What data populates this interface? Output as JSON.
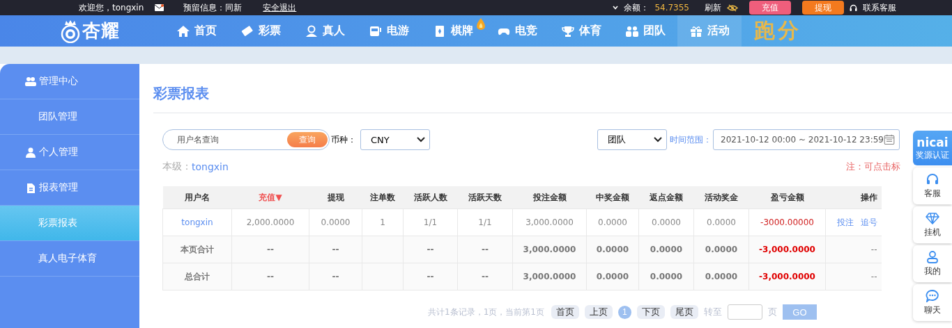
{
  "top_bar": {
    "welcome": "欢迎您，tongxin",
    "reserved_info": "预留信息：同新",
    "logout": "安全退出",
    "balance_label": "余额：",
    "balance": "54.7355",
    "refresh": "刷新",
    "deposit": "充值",
    "withdraw": "提现",
    "support": "联系客服"
  },
  "logo": "杏耀",
  "nav": [
    {
      "label": "首页",
      "selected": false,
      "hot": false
    },
    {
      "label": "彩票",
      "selected": false,
      "hot": false
    },
    {
      "label": "真人",
      "selected": false,
      "hot": false
    },
    {
      "label": "电游",
      "selected": false,
      "hot": false
    },
    {
      "label": "棋牌",
      "selected": false,
      "hot": true
    },
    {
      "label": "电竞",
      "selected": false,
      "hot": false
    },
    {
      "label": "体育",
      "selected": false,
      "hot": false
    },
    {
      "label": "团队",
      "selected": false,
      "hot": false
    },
    {
      "label": "活动",
      "selected": true,
      "hot": false
    }
  ],
  "nav_promo": "跑分",
  "sidebar": [
    {
      "label": "管理中心",
      "kind": "group",
      "selected": false
    },
    {
      "label": "团队管理",
      "kind": "item",
      "selected": false
    },
    {
      "label": "个人管理",
      "kind": "group",
      "selected": false
    },
    {
      "label": "报表管理",
      "kind": "group",
      "selected": false
    },
    {
      "label": "彩票报表",
      "kind": "item",
      "selected": true
    },
    {
      "label": "真人电子体育",
      "kind": "item",
      "selected": false
    }
  ],
  "page_title": "彩票报表",
  "filters": {
    "search_placeholder": "用户名查询",
    "search_button": "查询",
    "currency_label": "币种：",
    "currency": "CNY",
    "scope": "团队",
    "time_label": "时间范围：",
    "time_range": "2021-10-12 00:00 ~ 2021-10-12 23:59"
  },
  "level_label": "本级：",
  "level_user": "tongxin",
  "note": "注：可点击标",
  "table": {
    "columns": [
      {
        "label": "用户名",
        "sorted": false
      },
      {
        "label": "充值▼",
        "sorted": true
      },
      {
        "label": "提现",
        "sorted": false
      },
      {
        "label": "注单数",
        "sorted": false
      },
      {
        "label": "活跃人数",
        "sorted": false
      },
      {
        "label": "活跃天数",
        "sorted": false
      },
      {
        "label": "投注金额",
        "sorted": false
      },
      {
        "label": "中奖金额",
        "sorted": false
      },
      {
        "label": "返点金额",
        "sorted": false
      },
      {
        "label": "活动奖金",
        "sorted": false
      },
      {
        "label": "盈亏金额",
        "sorted": false
      },
      {
        "label": "操作",
        "sorted": false
      }
    ],
    "rows": [
      {
        "kind": "data",
        "cells": [
          "tongxin",
          "2,000.0000",
          "0.0000",
          "1",
          "1/1",
          "1/1",
          "3,000.0000",
          "0.0000",
          "0.0000",
          "0.0000",
          "-3000.00000"
        ],
        "actions": [
          "投注",
          "追号"
        ]
      },
      {
        "kind": "total",
        "cells": [
          "本页合计",
          "--",
          "--",
          "",
          "--",
          "--",
          "3,000.0000",
          "0.0000",
          "0.0000",
          "0.0000",
          "-3,000.0000",
          "--"
        ]
      },
      {
        "kind": "total",
        "cells": [
          "总合计",
          "--",
          "--",
          "",
          "--",
          "--",
          "3,000.0000",
          "0.0000",
          "0.0000",
          "0.0000",
          "-3,000.0000",
          "--"
        ]
      }
    ]
  },
  "pagination": {
    "summary": "共计1条记录，1页，当前第1页",
    "first": "首页",
    "prev": "上页",
    "pages": [
      {
        "label": "1",
        "selected": true
      }
    ],
    "next": "下页",
    "last": "尾页",
    "goto_label": "转至",
    "page_unit": "页",
    "go": "GO"
  },
  "float_panel": {
    "badge_top": "nicai",
    "badge_bottom": "奖源认证",
    "items": [
      {
        "label": "客服"
      },
      {
        "label": "挂机"
      },
      {
        "label": "我的"
      },
      {
        "label": "聊天"
      }
    ]
  }
}
